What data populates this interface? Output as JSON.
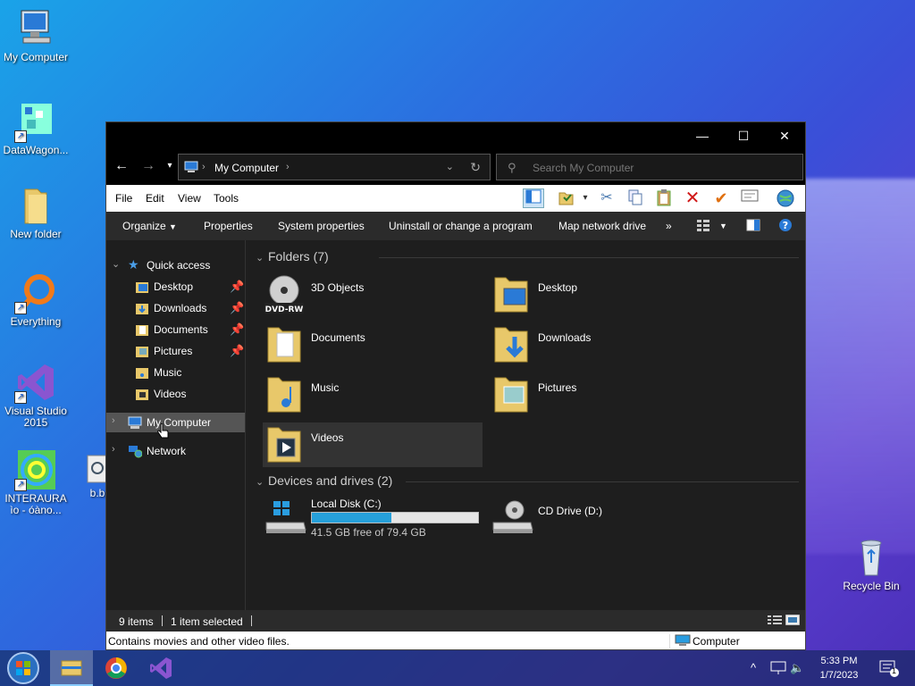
{
  "desktop": {
    "icons": [
      {
        "label": "My Computer"
      },
      {
        "label": "DataWagon..."
      },
      {
        "label": "New folder"
      },
      {
        "label": "Everything"
      },
      {
        "label": "Visual Studio 2015"
      },
      {
        "label": "INTERAURA ìo - óàno..."
      },
      {
        "label": "b.b"
      },
      {
        "label": "Recycle Bin"
      }
    ]
  },
  "window": {
    "buttons": {
      "minimize": "—",
      "maximize": "☐",
      "close": "✕"
    },
    "address": {
      "path": "My Computer"
    },
    "search": {
      "placeholder": "Search My Computer"
    },
    "menus": [
      "File",
      "Edit",
      "View",
      "Tools"
    ],
    "commands": [
      "Organize",
      "Properties",
      "System properties",
      "Uninstall or change a program",
      "Map network drive",
      "»"
    ],
    "nav": {
      "quick_access": "Quick access",
      "pinned": [
        "Desktop",
        "Downloads",
        "Documents",
        "Pictures"
      ],
      "unpinned": [
        "Music",
        "Videos"
      ],
      "my_computer": "My Computer",
      "network": "Network"
    },
    "groups": {
      "folders": "Folders (7)",
      "devices": "Devices and drives (2)"
    },
    "folders": [
      "3D Objects",
      "Desktop",
      "Documents",
      "Downloads",
      "Music",
      "Pictures",
      "Videos"
    ],
    "drives": [
      {
        "name": "Local Disk (C:)",
        "free_text": "41.5 GB free of 79.4 GB",
        "used_fraction": 0.477
      },
      {
        "name": "CD Drive (D:)"
      }
    ],
    "status": {
      "items": "9 items",
      "selected": "1 item selected"
    },
    "details": {
      "description": "Contains movies and other video files.",
      "location": "Computer"
    }
  },
  "taskbar": {
    "time": "5:33 PM",
    "date": "1/7/2023",
    "notification_count": "1"
  },
  "colors": {
    "accent": "#26a0da",
    "window_bg": "#1e1e1e"
  }
}
